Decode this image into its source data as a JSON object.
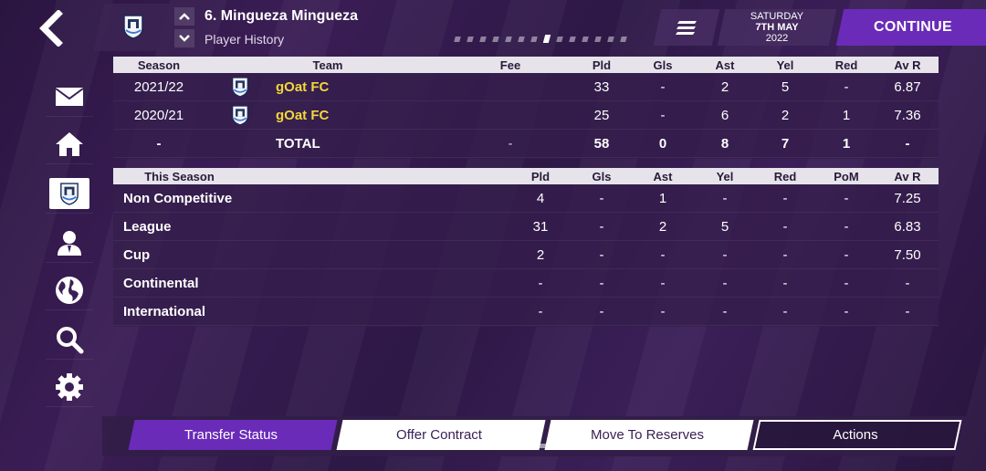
{
  "header": {
    "player_name": "6. Mingueza Mingueza",
    "subtitle": "Player History",
    "date": {
      "day": "SATURDAY",
      "date": "7TH MAY",
      "year": "2022"
    },
    "continue_label": "CONTINUE",
    "page_count": 14,
    "active_page": 8
  },
  "sidebar": {
    "items": [
      {
        "icon": "mail-icon"
      },
      {
        "icon": "home-icon"
      },
      {
        "icon": "club-crest-icon",
        "active": true
      },
      {
        "icon": "person-icon"
      },
      {
        "icon": "globe-icon"
      },
      {
        "icon": "search-icon"
      },
      {
        "icon": "settings-icon"
      }
    ]
  },
  "history_table": {
    "headers": {
      "season": "Season",
      "team": "Team",
      "fee": "Fee",
      "pld": "Pld",
      "gls": "Gls",
      "ast": "Ast",
      "yel": "Yel",
      "red": "Red",
      "avr": "Av R"
    },
    "rows": [
      {
        "season": "2021/22",
        "team": "gOat FC",
        "fee": "",
        "pld": "33",
        "gls": "-",
        "ast": "2",
        "yel": "5",
        "red": "-",
        "avr": "6.87"
      },
      {
        "season": "2020/21",
        "team": "gOat FC",
        "fee": "",
        "pld": "25",
        "gls": "-",
        "ast": "6",
        "yel": "2",
        "red": "1",
        "avr": "7.36"
      }
    ],
    "total": {
      "season": "-",
      "team": "TOTAL",
      "fee": "-",
      "pld": "58",
      "gls": "0",
      "ast": "8",
      "yel": "7",
      "red": "1",
      "avr": "-"
    }
  },
  "season_table": {
    "headers": {
      "comp": "This Season",
      "pld": "Pld",
      "gls": "Gls",
      "ast": "Ast",
      "yel": "Yel",
      "red": "Red",
      "pom": "PoM",
      "avr": "Av R"
    },
    "rows": [
      {
        "comp": "Non Competitive",
        "pld": "4",
        "gls": "-",
        "ast": "1",
        "yel": "-",
        "red": "-",
        "pom": "-",
        "avr": "7.25"
      },
      {
        "comp": "League",
        "pld": "31",
        "gls": "-",
        "ast": "2",
        "yel": "5",
        "red": "-",
        "pom": "-",
        "avr": "6.83"
      },
      {
        "comp": "Cup",
        "pld": "2",
        "gls": "-",
        "ast": "-",
        "yel": "-",
        "red": "-",
        "pom": "-",
        "avr": "7.50"
      },
      {
        "comp": "Continental",
        "pld": "-",
        "gls": "-",
        "ast": "-",
        "yel": "-",
        "red": "-",
        "pom": "-",
        "avr": "-"
      },
      {
        "comp": "International",
        "pld": "-",
        "gls": "-",
        "ast": "-",
        "yel": "-",
        "red": "-",
        "pom": "-",
        "avr": "-"
      }
    ]
  },
  "actions": {
    "transfer_status": "Transfer Status",
    "offer_contract": "Offer Contract",
    "move_to_reserves": "Move To Reserves",
    "actions": "Actions"
  },
  "colors": {
    "accent": "#6a2bb8",
    "team_highlight": "#f2d73a",
    "background": "#2d1846"
  }
}
